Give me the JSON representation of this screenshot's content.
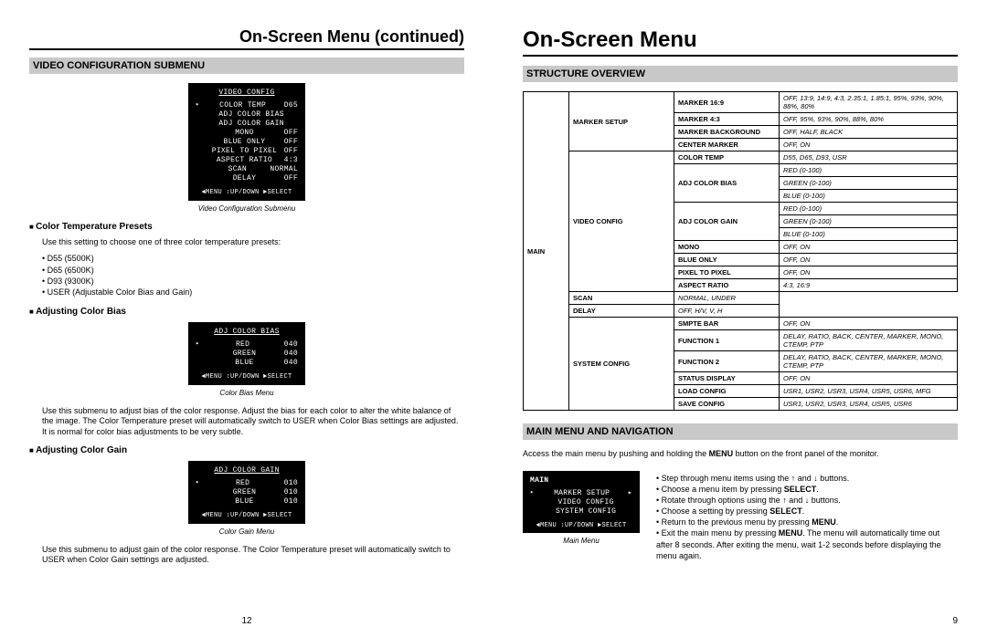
{
  "leftPage": {
    "contTitle": "On-Screen Menu (continued)",
    "section": "VIDEO CONFIGURATION SUBMENU",
    "lcd1": {
      "header": "VIDEO CONFIG",
      "rows": [
        [
          "COLOR TEMP",
          "D65",
          true
        ],
        [
          "ADJ COLOR BIAS",
          "",
          false
        ],
        [
          "ADJ COLOR GAIN",
          "",
          false
        ],
        [
          "MONO",
          "OFF",
          false
        ],
        [
          "BLUE ONLY",
          "OFF",
          false
        ],
        [
          "PIXEL TO PIXEL",
          "OFF",
          false
        ],
        [
          "ASPECT RATIO",
          "4:3",
          false
        ],
        [
          "SCAN",
          "NORMAL",
          false
        ],
        [
          "DELAY",
          "OFF",
          false
        ]
      ],
      "footer": "◄MENU ↕UP/DOWN ►SELECT",
      "caption": "Video Configuration Submenu"
    },
    "h3a": "Color Temperature Presets",
    "textA": "Use this setting to choose one of three color temperature presets:",
    "listA": [
      "D55 (5500K)",
      "D65 (6500K)",
      "D93 (9300K)",
      "USER (Adjustable Color Bias and Gain)"
    ],
    "h3b": "Adjusting Color Bias",
    "lcd2": {
      "header": "ADJ COLOR BIAS",
      "rows": [
        [
          "RED",
          "040",
          true
        ],
        [
          "GREEN",
          "040",
          false
        ],
        [
          "BLUE",
          "040",
          false
        ]
      ],
      "footer": "◄MENU ↕UP/DOWN ►SELECT",
      "caption": "Color Bias Menu"
    },
    "textB": "Use this submenu to adjust bias of the color response. Adjust the bias for each color to alter the white balance of the image. The Color Temperature preset will automatically switch to USER when Color Bias settings are adjusted. It is normal for color bias adjustments to be very subtle.",
    "h3c": "Adjusting Color Gain",
    "lcd3": {
      "header": "ADJ COLOR GAIN",
      "rows": [
        [
          "RED",
          "010",
          true
        ],
        [
          "GREEN",
          "010",
          false
        ],
        [
          "BLUE",
          "010",
          false
        ]
      ],
      "footer": "◄MENU ↕UP/DOWN ►SELECT",
      "caption": "Color Gain Menu"
    },
    "textC": "Use this submenu to adjust gain of the color response. The Color Temperature preset will automatically switch to USER when Color Gain settings are adjusted.",
    "pageNum": "12"
  },
  "rightPage": {
    "title": "On-Screen Menu",
    "section1": "STRUCTURE OVERVIEW",
    "tableRows": [
      {
        "c2": "MARKER SETUP",
        "c2span": 4,
        "c3": "MARKER 16:9",
        "c4": "OFF, 13:9, 14:9, 4:3, 2.35:1, 1.85:1, 95%, 93%, 90%, 88%, 80%",
        "c4i": true
      },
      {
        "c3": "MARKER 4:3",
        "c4": "OFF, 95%, 93%, 90%, 88%, 80%",
        "c4i": true
      },
      {
        "c3": "MARKER BACKGROUND",
        "c4": "OFF, HALF, BLACK",
        "c4i": true
      },
      {
        "c3": "CENTER MARKER",
        "c4": "OFF, ON",
        "c4i": true
      },
      {
        "c2": "VIDEO CONFIG",
        "c2span": 11,
        "c3": "COLOR TEMP",
        "c4": "D55, D65, D93, USR",
        "c4i": true
      },
      {
        "c3": "ADJ COLOR BIAS",
        "c3span": 3,
        "c4": "RED (0-100)",
        "c4i": true
      },
      {
        "c4": "GREEN (0-100)",
        "c4i": true
      },
      {
        "c4": "BLUE (0-100)",
        "c4i": true
      },
      {
        "c3": "ADJ COLOR GAIN",
        "c3span": 3,
        "c4": "RED (0-100)",
        "c4i": true
      },
      {
        "c4": "GREEN (0-100)",
        "c4i": true
      },
      {
        "c4": "BLUE (0-100)",
        "c4i": true
      },
      {
        "c3": "MONO",
        "c4": "OFF, ON",
        "c4i": true
      },
      {
        "c3": "BLUE ONLY",
        "c4": "OFF, ON",
        "c4i": true
      },
      {
        "c3": "PIXEL TO PIXEL",
        "c4": "OFF, ON",
        "c4i": true
      },
      {
        "c3": "ASPECT RATIO",
        "c4": "4:3, 16:9",
        "c4i": true
      },
      {
        "c3": "SCAN",
        "c4": "NORMAL, UNDER",
        "c4i": true
      },
      {
        "c3": "DELAY",
        "c4": "OFF, H/V, V, H",
        "c4i": true
      },
      {
        "c2": "SYSTEM CONFIG",
        "c2span": 6,
        "c3": "SMPTE BAR",
        "c4": "OFF, ON",
        "c4i": true
      },
      {
        "c3": "FUNCTION 1",
        "c4": "DELAY, RATIO, BACK, CENTER, MARKER, MONO, CTEMP, PTP",
        "c4i": true
      },
      {
        "c3": "FUNCTION 2",
        "c4": "DELAY, RATIO, BACK, CENTER, MARKER, MONO, CTEMP, PTP",
        "c4i": true
      },
      {
        "c3": "STATUS DISPLAY",
        "c4": "OFF, ON",
        "c4i": true
      },
      {
        "c3": "LOAD CONFIG",
        "c4": "USR1, USR2, USR3, USR4, USR5, USR6, MFG",
        "c4i": true
      },
      {
        "c3": "SAVE CONFIG",
        "c4": "USR1, USR2, USR3, USR4, USR5, USR6",
        "c4i": true
      }
    ],
    "mainLabel": "MAIN",
    "section2": "MAIN MENU AND NAVIGATION",
    "navIntroA": "Access the main menu by pushing and holding the ",
    "navIntroBold": "MENU",
    "navIntroB": " button on the front panel of the monitor.",
    "lcd4": {
      "header": "MAIN",
      "rows": [
        [
          "MARKER SETUP",
          "▸",
          true
        ],
        [
          "VIDEO CONFIG",
          "",
          false
        ],
        [
          "SYSTEM CONFIG",
          "",
          false
        ]
      ],
      "footer": "◄MENU ↕UP/DOWN ►SELECT",
      "caption": "Main Menu"
    },
    "navList": [
      "Step through menu items using the ↑ and ↓ buttons.",
      "Choose a menu item by pressing <b>SELECT</b>.",
      "Rotate through options using the ↑ and ↓ buttons.",
      "Choose a setting by pressing <b>SELECT</b>.",
      "Return to the previous menu by pressing <b>MENU</b>.",
      "Exit the main menu by pressing <b>MENU</b>. The menu will automatically time out after 8 seconds. After exiting the menu, wait 1-2 seconds before displaying the menu again."
    ],
    "pageNum": "9"
  }
}
